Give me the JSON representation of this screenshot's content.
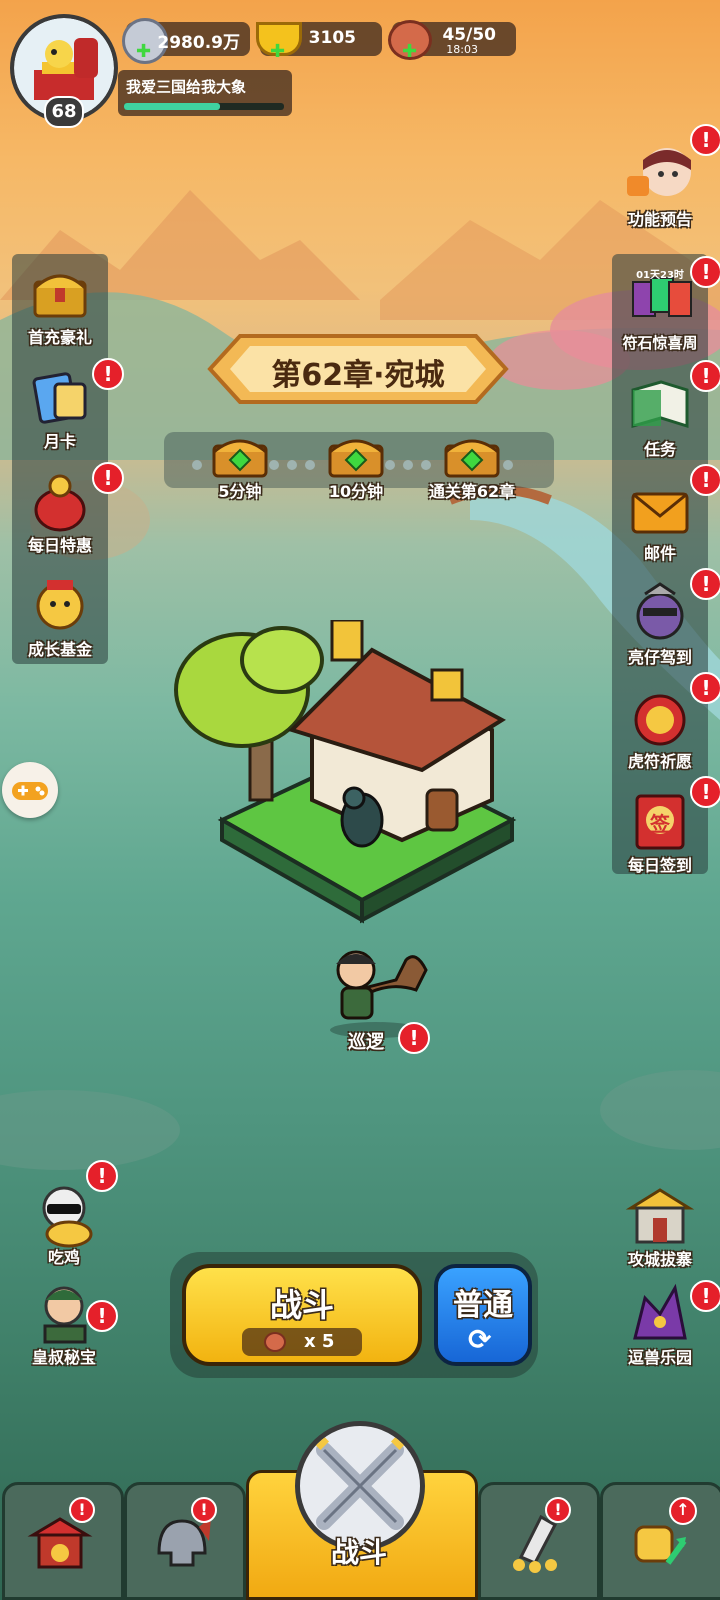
{
  "player": {
    "level": "68",
    "name": "我爱三国给我大象",
    "exp_fraction": 0.6
  },
  "resources": {
    "silver": {
      "value": "2980.9万",
      "icon": "silver-coin-icon"
    },
    "gold": {
      "value": "3105",
      "icon": "gold-ingot-icon"
    },
    "stamina": {
      "value": "45/50",
      "timer": "18:03",
      "icon": "meat-icon"
    }
  },
  "left_menu": [
    {
      "label": "首充豪礼",
      "icon": "treasure-chest-icon",
      "alert": false
    },
    {
      "label": "月卡",
      "icon": "month-card-icon",
      "alert": true
    },
    {
      "label": "每日特惠",
      "icon": "gift-bag-icon",
      "alert": true
    },
    {
      "label": "成长基金",
      "icon": "fund-monkey-icon",
      "alert": false
    }
  ],
  "right_top": {
    "label": "功能预告",
    "icon": "megaphone-girl-icon",
    "alert": true
  },
  "right_menu": [
    {
      "label": "符石惊喜周",
      "sub": "01天23时",
      "icon": "rune-cards-icon",
      "alert": true
    },
    {
      "label": "任务",
      "icon": "task-book-icon",
      "alert": true
    },
    {
      "label": "邮件",
      "icon": "mail-icon",
      "alert": true
    },
    {
      "label": "亮仔驾到",
      "icon": "liangzai-icon",
      "alert": true
    },
    {
      "label": "虎符祈愿",
      "icon": "tiger-tally-icon",
      "alert": true
    },
    {
      "label": "每日签到",
      "icon": "sign-in-icon",
      "sign_char": "签",
      "alert": true
    }
  ],
  "chapter": {
    "title": "第62章·宛城",
    "rewards": [
      {
        "label": "5分钟"
      },
      {
        "label": "10分钟"
      },
      {
        "label": "通关第62章"
      }
    ]
  },
  "patrol": {
    "label": "巡逻"
  },
  "left_bottom": [
    {
      "label": "吃鸡",
      "icon": "chicken-icon",
      "alert": true
    },
    {
      "label": "皇叔秘宝",
      "icon": "uncle-treasure-icon",
      "alert": true
    }
  ],
  "right_bottom": [
    {
      "label": "攻城拔寨",
      "icon": "siege-gate-icon",
      "alert": false
    },
    {
      "label": "逗兽乐园",
      "icon": "beast-park-icon",
      "alert": true
    }
  ],
  "battle": {
    "label": "战斗",
    "cost": "x 5",
    "mode": "普通"
  },
  "nav": [
    {
      "label": "",
      "icon": "city-gate-icon",
      "alert": true
    },
    {
      "label": "",
      "icon": "helmet-icon",
      "alert": true
    },
    {
      "label": "战斗",
      "icon": "crossed-swords-icon",
      "alert": false
    },
    {
      "label": "",
      "icon": "ranking-stars-icon",
      "alert": true
    },
    {
      "label": "",
      "icon": "upgrade-fist-icon",
      "alert": false
    }
  ],
  "colors": {
    "accent_yellow": "#f6c21c",
    "alert_red": "#e5202a",
    "mode_blue": "#1f7fe0"
  }
}
